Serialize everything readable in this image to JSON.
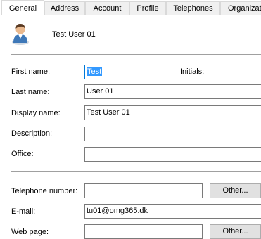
{
  "tabs": [
    {
      "label": "General"
    },
    {
      "label": "Address"
    },
    {
      "label": "Account"
    },
    {
      "label": "Profile"
    },
    {
      "label": "Telephones"
    },
    {
      "label": "Organizati"
    }
  ],
  "header": {
    "user_name": "Test User 01",
    "icon": "user-avatar-icon"
  },
  "fields": {
    "first_name": {
      "label": "First name:",
      "value": "Test"
    },
    "initials": {
      "label": "Initials:",
      "value": ""
    },
    "last_name": {
      "label": "Last name:",
      "value": "User 01"
    },
    "display_name": {
      "label": "Display name:",
      "value": "Test User 01"
    },
    "description": {
      "label": "Description:",
      "value": ""
    },
    "office": {
      "label": "Office:",
      "value": ""
    },
    "telephone": {
      "label": "Telephone number:",
      "value": "",
      "button": "Other..."
    },
    "email": {
      "label": "E-mail:",
      "value": "tu01@omg365.dk"
    },
    "web_page": {
      "label": "Web page:",
      "value": "",
      "button": "Other..."
    }
  },
  "colors": {
    "selection": "#3399ff",
    "focus_border": "#0078d7"
  }
}
